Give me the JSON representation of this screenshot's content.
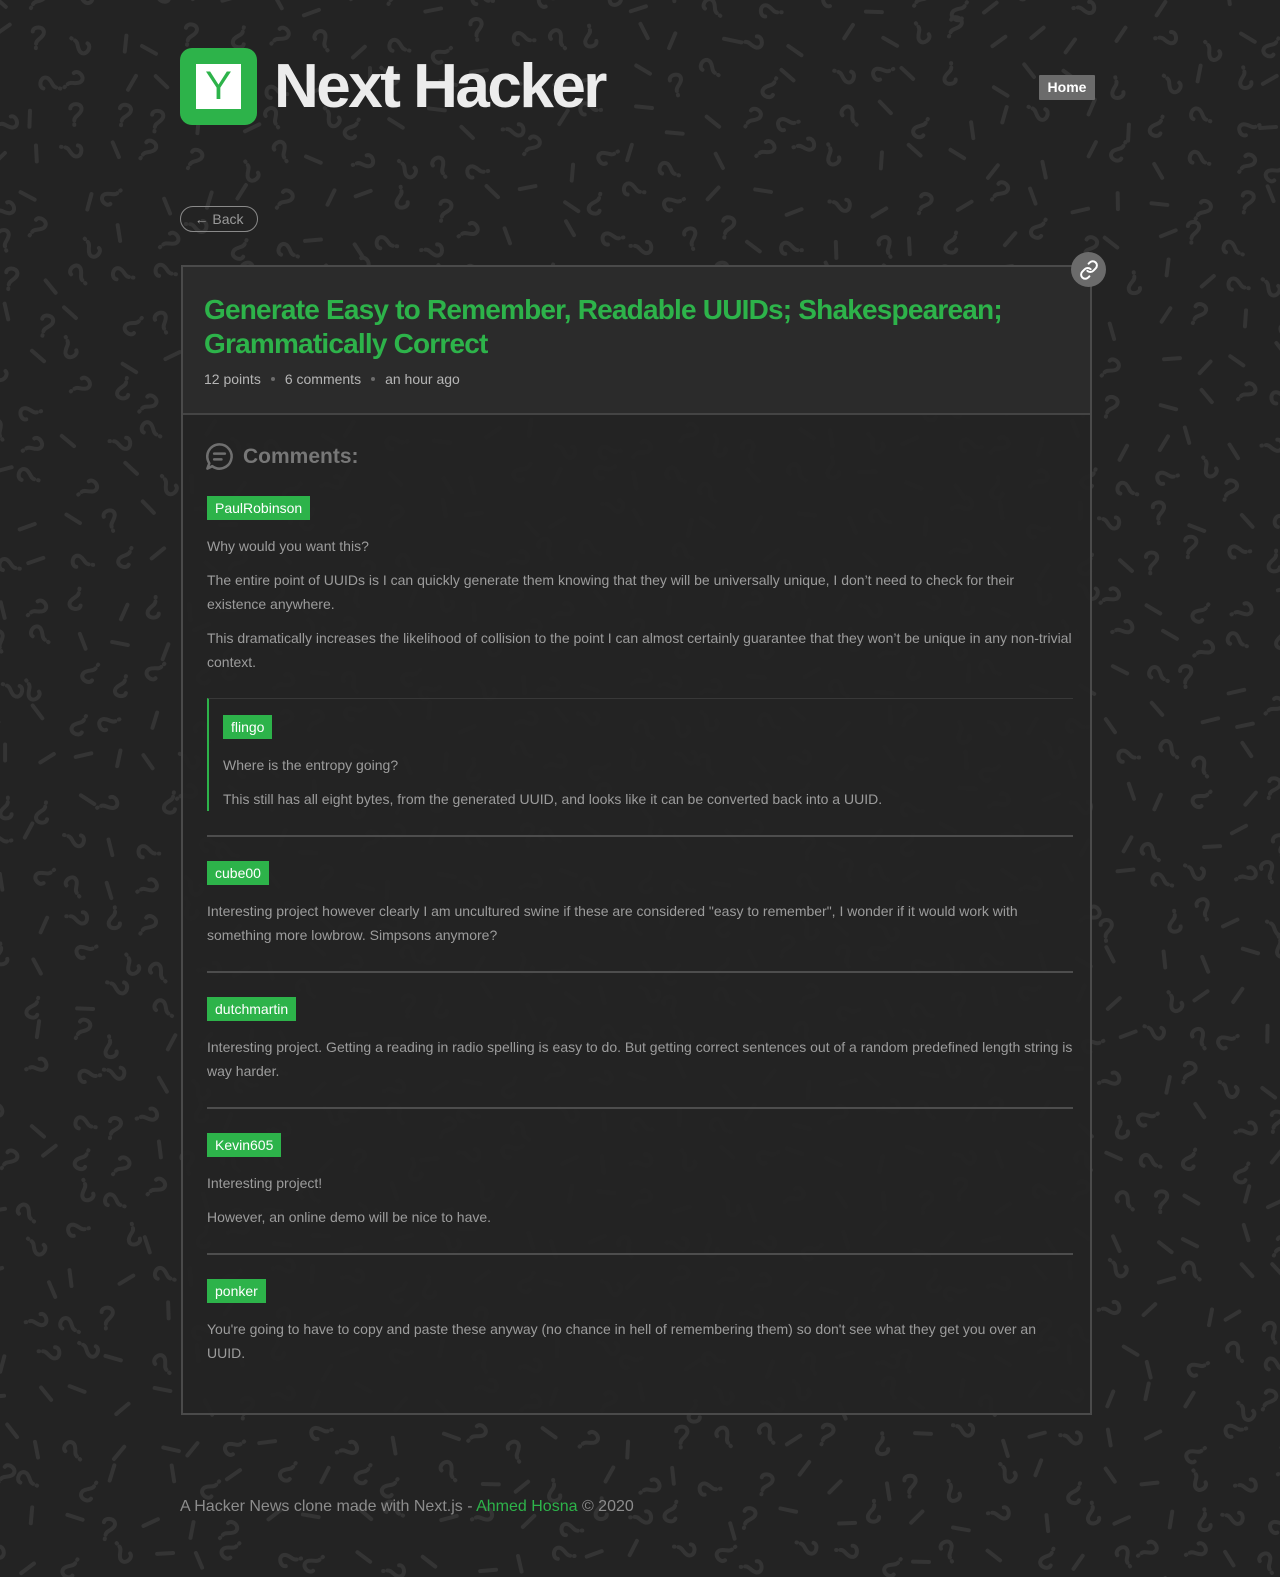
{
  "header": {
    "logo_letter": "Y",
    "site_title": "Next Hacker",
    "home_label": "Home"
  },
  "back_label": "← Back",
  "story": {
    "title": "Generate Easy to Remember, Readable UUIDs; Shakespearean; Grammatically Correct",
    "points": "12 points",
    "comments_count": "6 comments",
    "time": "an hour ago"
  },
  "comments_heading": "Comments:",
  "comments": [
    {
      "author": "PaulRobinson",
      "paragraphs": [
        "Why would you want this?",
        "The entire point of UUIDs is I can quickly generate them knowing that they will be universally unique, I don’t need to check for their existence anywhere.",
        "This dramatically increases the likelihood of collision to the point I can almost certainly guarantee that they won’t be unique in any non-trivial context."
      ],
      "reply": {
        "author": "flingo",
        "paragraphs": [
          "Where is the entropy going?",
          "This still has all eight bytes, from the generated UUID, and looks like it can be converted back into a UUID."
        ]
      }
    },
    {
      "author": "cube00",
      "paragraphs": [
        "Interesting project however clearly I am uncultured swine if these are considered \"easy to remember\", I wonder if it would work with something more lowbrow. Simpsons anymore?"
      ]
    },
    {
      "author": "dutchmartin",
      "paragraphs": [
        "Interesting project. Getting a reading in radio spelling is easy to do. But getting correct sentences out of a random predefined length string is way harder."
      ]
    },
    {
      "author": "Kevin605",
      "paragraphs": [
        "Interesting project!",
        "However, an online demo will be nice to have."
      ]
    },
    {
      "author": "ponker",
      "paragraphs": [
        "You're going to have to copy and paste these anyway (no chance in hell of remembering them) so don't see what they get you over an UUID."
      ]
    }
  ],
  "footer": {
    "text": "A Hacker News clone made with Next.js - ",
    "author": "Ahmed Hosna",
    "copyright": " © 2020"
  },
  "colors": {
    "accent": "#2db34a",
    "background": "#232323",
    "card": "#2c2c2c"
  },
  "icons": [
    "logo-icon",
    "link-icon",
    "comments-icon"
  ]
}
